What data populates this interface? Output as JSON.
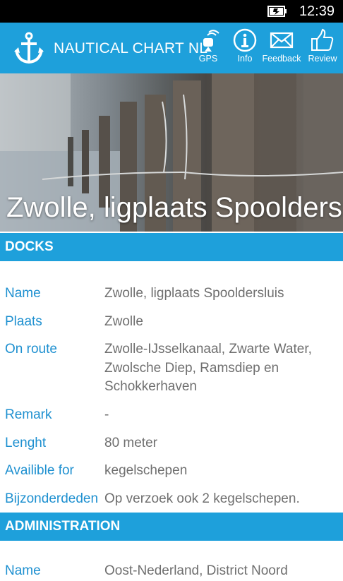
{
  "status": {
    "time": "12:39",
    "battery_icon": "battery-charging-icon"
  },
  "app_bar": {
    "title": "NAUTICAL CHART  NL",
    "buttons": [
      {
        "label": "GPS",
        "icon": "gps-icon"
      },
      {
        "label": "Info",
        "icon": "info-icon"
      },
      {
        "label": "Feedback",
        "icon": "envelope-icon"
      },
      {
        "label": "Review",
        "icon": "thumbs-up-icon"
      }
    ]
  },
  "hero": {
    "title": "Zwolle, ligplaats Spoolders"
  },
  "docks": {
    "header": "DOCKS",
    "rows": [
      {
        "key": "Name",
        "value": "Zwolle, ligplaats Spooldersluis"
      },
      {
        "key": "Plaats",
        "value": "Zwolle"
      },
      {
        "key": "On route",
        "value": "Zwolle-IJsselkanaal, Zwarte Water, Zwolsche Diep, Ramsdiep en Schokkerhaven"
      },
      {
        "key": "Remark",
        "value": "-"
      },
      {
        "key": "Lenght",
        "value": "80 meter"
      },
      {
        "key": "Availible for",
        "value": "kegelschepen"
      },
      {
        "key": "Bijzonderdeden",
        "value": "Op verzoek ook 2 kegelschepen."
      }
    ]
  },
  "administration": {
    "header": "ADMINISTRATION",
    "rows": [
      {
        "key": "Name",
        "value": "Oost-Nederland, District Noord"
      }
    ]
  },
  "colors": {
    "accent": "#1ea0db",
    "key_text": "#1e90d0",
    "value_text": "#6f6f6f"
  }
}
